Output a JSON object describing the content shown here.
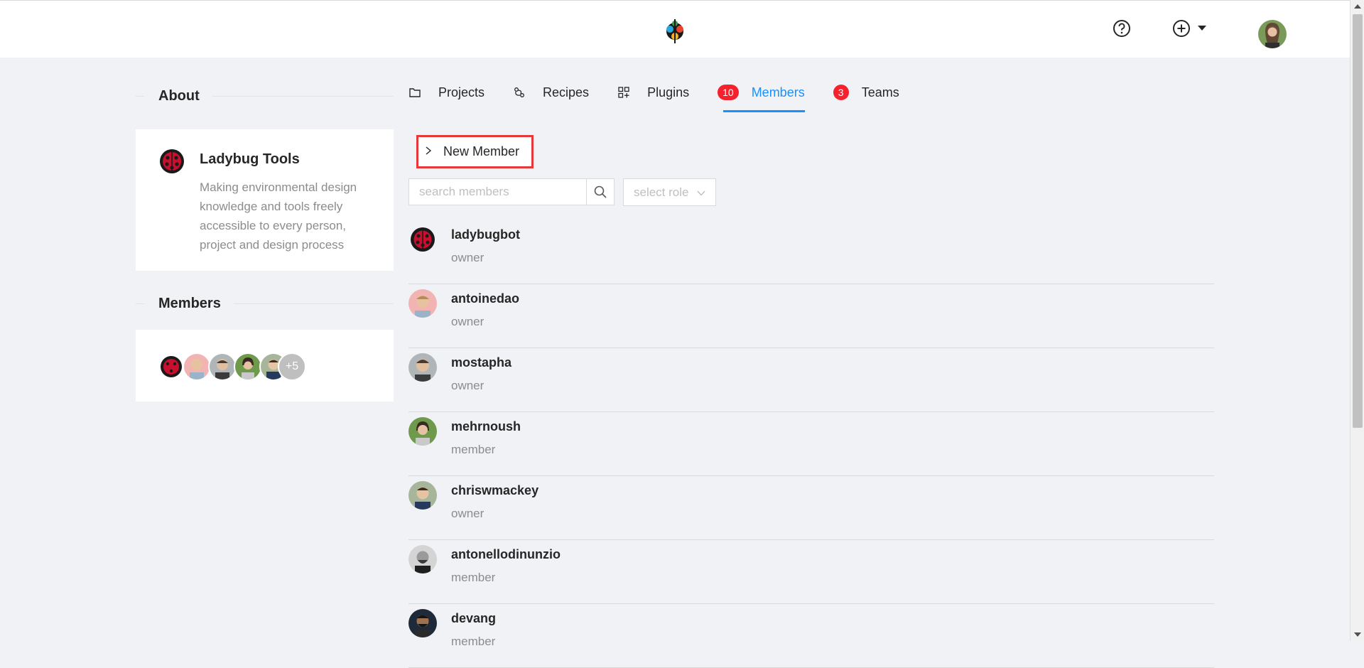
{
  "header": {
    "logo_icon": "ladybug-tools-logo-icon",
    "help_icon": "question-circle-icon",
    "add_icon": "plus-circle-icon",
    "user_avatar": "user-avatar"
  },
  "sidebar": {
    "about_heading": "About",
    "org": {
      "name": "Ladybug Tools",
      "description": "Making environmental design knowledge and tools freely accessible to every person, project and design process"
    },
    "members_heading": "Members",
    "members_more": "+5"
  },
  "tabs": [
    {
      "label": "Projects",
      "icon": "folder-icon"
    },
    {
      "label": "Recipes",
      "icon": "recipe-icon"
    },
    {
      "label": "Plugins",
      "icon": "plugin-icon"
    },
    {
      "label": "Members",
      "badge": "10",
      "active": true
    },
    {
      "label": "Teams",
      "badge": "3"
    }
  ],
  "toolbar": {
    "new_member_label": "New Member",
    "search_placeholder": "search members",
    "role_placeholder": "select role"
  },
  "members": [
    {
      "name": "ladybugbot",
      "role": "owner"
    },
    {
      "name": "antoinedao",
      "role": "owner"
    },
    {
      "name": "mostapha",
      "role": "owner"
    },
    {
      "name": "mehrnoush",
      "role": "member"
    },
    {
      "name": "chriswmackey",
      "role": "owner"
    },
    {
      "name": "antonellodinunzio",
      "role": "member"
    },
    {
      "name": "devang",
      "role": "member"
    }
  ],
  "colors": {
    "accent": "#1890ff",
    "badge": "#f5222d",
    "highlight": "#e5383b"
  }
}
